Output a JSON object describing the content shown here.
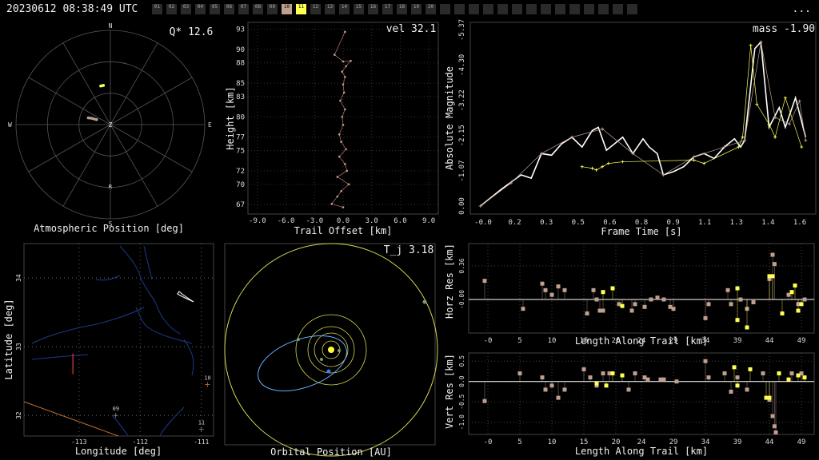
{
  "header": {
    "timestamp": "20230612 08:38:49 UTC",
    "more_label": "...",
    "stations": [
      {
        "label": "01",
        "active": false,
        "color": "#555555"
      },
      {
        "label": "02",
        "active": false,
        "color": "#555555"
      },
      {
        "label": "03",
        "active": false,
        "color": "#555555"
      },
      {
        "label": "04",
        "active": false,
        "color": "#555555"
      },
      {
        "label": "05",
        "active": false,
        "color": "#555555"
      },
      {
        "label": "06",
        "active": false,
        "color": "#555555"
      },
      {
        "label": "07",
        "active": false,
        "color": "#555555"
      },
      {
        "label": "08",
        "active": false,
        "color": "#555555"
      },
      {
        "label": "09",
        "active": false,
        "color": "#555555"
      },
      {
        "label": "10",
        "active": true,
        "color": "#bfa090"
      },
      {
        "label": "11",
        "active": true,
        "color": "#ffff55"
      },
      {
        "label": "12",
        "active": false,
        "color": "#555555"
      },
      {
        "label": "13",
        "active": false,
        "color": "#555555"
      },
      {
        "label": "14",
        "active": false,
        "color": "#555555"
      },
      {
        "label": "15",
        "active": false,
        "color": "#555555"
      },
      {
        "label": "16",
        "active": false,
        "color": "#555555"
      },
      {
        "label": "17",
        "active": false,
        "color": "#555555"
      },
      {
        "label": "18",
        "active": false,
        "color": "#555555"
      },
      {
        "label": "19",
        "active": false,
        "color": "#555555"
      },
      {
        "label": "20",
        "active": false,
        "color": "#555555"
      },
      {
        "label": "",
        "active": false,
        "color": "#333333"
      },
      {
        "label": "",
        "active": false,
        "color": "#333333"
      },
      {
        "label": "",
        "active": false,
        "color": "#333333"
      },
      {
        "label": "",
        "active": false,
        "color": "#333333"
      },
      {
        "label": "",
        "active": false,
        "color": "#333333"
      },
      {
        "label": "",
        "active": false,
        "color": "#333333"
      },
      {
        "label": "",
        "active": false,
        "color": "#333333"
      },
      {
        "label": "",
        "active": false,
        "color": "#333333"
      },
      {
        "label": "",
        "active": false,
        "color": "#333333"
      },
      {
        "label": "",
        "active": false,
        "color": "#333333"
      },
      {
        "label": "",
        "active": false,
        "color": "#333333"
      },
      {
        "label": "",
        "active": false,
        "color": "#333333"
      },
      {
        "label": "",
        "active": false,
        "color": "#333333"
      },
      {
        "label": "",
        "active": false,
        "color": "#333333"
      }
    ]
  },
  "colors": {
    "station_10": "#bfa090",
    "station_11": "#ffff55",
    "grid": "#555555",
    "orbit": "#6ab0ff",
    "orbit_ring": "#d8d850",
    "curve": "#ffffff"
  },
  "chart_data": [
    {
      "id": "polar",
      "type": "scatter",
      "xlabel": "Atmospheric Position [deg]",
      "stat": "Q* 12.6",
      "directions": [
        "N",
        "E",
        "S",
        "W",
        "Z",
        "R"
      ],
      "series": [
        {
          "station": "10",
          "points": [
            [
              -73,
              68
            ],
            [
              -72,
              70
            ],
            [
              -71,
              72
            ],
            [
              -71,
              74
            ],
            [
              -70,
              76
            ]
          ]
        },
        {
          "station": "11",
          "points": [
            [
              -10,
              52
            ],
            [
              -12,
              52
            ],
            [
              -14,
              52
            ]
          ]
        }
      ]
    },
    {
      "id": "height",
      "type": "scatter",
      "xlabel": "Trail Offset [km]",
      "ylabel": "Height [km]",
      "stat": "vel 32.1",
      "xlim": [
        -10,
        10
      ],
      "ylim": [
        65.6,
        94
      ],
      "xticks": [
        "-9.0",
        "-6.0",
        "-3.0",
        "0.0",
        "3.0",
        "6.0",
        "9.0"
      ],
      "yticks": [
        "67",
        "70",
        "72",
        "75",
        "77",
        "80",
        "83",
        "85",
        "88",
        "90",
        "93"
      ],
      "points": [
        [
          0.2,
          92.6
        ],
        [
          -0.9,
          89.2
        ],
        [
          0.0,
          88.2
        ],
        [
          0.8,
          88.3
        ],
        [
          0.3,
          87.5
        ],
        [
          -0.1,
          86.7
        ],
        [
          0.2,
          85.9
        ],
        [
          0.0,
          84.8
        ],
        [
          0.1,
          83.6
        ],
        [
          -0.3,
          82.4
        ],
        [
          0.2,
          81.1
        ],
        [
          -0.1,
          80.0
        ],
        [
          0.0,
          78.8
        ],
        [
          -0.4,
          77.4
        ],
        [
          -0.2,
          76.3
        ],
        [
          0.3,
          75.2
        ],
        [
          -0.4,
          74.1
        ],
        [
          0.2,
          73.0
        ],
        [
          0.4,
          72.0
        ],
        [
          -0.6,
          71.1
        ],
        [
          0.6,
          70.0
        ],
        [
          -0.2,
          69.0
        ],
        [
          -0.6,
          68.2
        ],
        [
          -1.2,
          67.1
        ],
        [
          0.0,
          66.6
        ]
      ]
    },
    {
      "id": "magnitude",
      "type": "line",
      "xlabel": "Frame Time [s]",
      "ylabel": "Absolute Magnitude",
      "stat": "mass -1.90",
      "xlim": [
        -0.05,
        1.65
      ],
      "ylim": [
        0,
        -5.6
      ],
      "xticks": [
        "-0.0",
        "0.2",
        "0.3",
        "0.5",
        "0.6",
        "0.8",
        "0.9",
        "1.1",
        "1.3",
        "1.4",
        "1.6"
      ],
      "yticks": [
        "0.00",
        "-1.07",
        "-2.15",
        "-3.22",
        "-4.30",
        "-5.37"
      ],
      "fit_curve": [
        [
          0.0,
          0.0
        ],
        [
          0.1,
          -0.5
        ],
        [
          0.2,
          -0.95
        ],
        [
          0.25,
          -0.85
        ],
        [
          0.3,
          -1.6
        ],
        [
          0.35,
          -1.55
        ],
        [
          0.4,
          -1.9
        ],
        [
          0.45,
          -2.1
        ],
        [
          0.5,
          -1.8
        ],
        [
          0.55,
          -2.3
        ],
        [
          0.58,
          -2.4
        ],
        [
          0.62,
          -1.7
        ],
        [
          0.67,
          -1.95
        ],
        [
          0.7,
          -2.1
        ],
        [
          0.75,
          -1.6
        ],
        [
          0.8,
          -2.05
        ],
        [
          0.83,
          -1.8
        ],
        [
          0.87,
          -1.6
        ],
        [
          0.9,
          -0.95
        ],
        [
          0.95,
          -1.05
        ],
        [
          1.0,
          -1.2
        ],
        [
          1.05,
          -1.5
        ],
        [
          1.1,
          -1.6
        ],
        [
          1.15,
          -1.45
        ],
        [
          1.2,
          -1.8
        ],
        [
          1.25,
          -2.05
        ],
        [
          1.28,
          -1.8
        ],
        [
          1.3,
          -2.0
        ],
        [
          1.35,
          -4.8
        ],
        [
          1.38,
          -5.0
        ],
        [
          1.42,
          -2.4
        ],
        [
          1.47,
          -3.0
        ],
        [
          1.5,
          -2.4
        ],
        [
          1.55,
          -3.3
        ],
        [
          1.6,
          -2.1
        ]
      ],
      "series": [
        {
          "station": "10",
          "points": [
            [
              0.0,
              0.0
            ],
            [
              0.15,
              -0.7
            ],
            [
              0.3,
              -1.6
            ],
            [
              0.45,
              -2.1
            ],
            [
              0.6,
              -2.35
            ],
            [
              0.75,
              -1.6
            ],
            [
              0.9,
              -0.95
            ],
            [
              1.05,
              -1.5
            ],
            [
              1.2,
              -1.8
            ],
            [
              1.3,
              -2.0
            ],
            [
              1.38,
              -5.0
            ],
            [
              1.45,
              -2.7
            ],
            [
              1.52,
              -2.5
            ],
            [
              1.57,
              -3.2
            ],
            [
              1.6,
              -2.0
            ]
          ]
        },
        {
          "station": "11",
          "points": [
            [
              0.5,
              -1.2
            ],
            [
              0.55,
              -1.15
            ],
            [
              0.57,
              -1.1
            ],
            [
              0.6,
              -1.2
            ],
            [
              0.63,
              -1.3
            ],
            [
              0.7,
              -1.35
            ],
            [
              1.05,
              -1.4
            ],
            [
              1.1,
              -1.3
            ],
            [
              1.27,
              -1.8
            ],
            [
              1.29,
              -2.1
            ],
            [
              1.33,
              -4.9
            ],
            [
              1.36,
              -3.1
            ],
            [
              1.42,
              -2.5
            ],
            [
              1.45,
              -2.1
            ],
            [
              1.5,
              -3.3
            ],
            [
              1.58,
              -1.8
            ]
          ]
        }
      ]
    },
    {
      "id": "map",
      "type": "scatter",
      "xlabel": "Longitude [deg]",
      "ylabel": "Latitude [deg]",
      "xlim": [
        -113.9,
        -110.8
      ],
      "ylim": [
        31.7,
        34.5
      ],
      "xticks": [
        "-113",
        "-112",
        "-111"
      ],
      "yticks": [
        "32",
        "33",
        "34"
      ],
      "station_labels": [
        {
          "label": "10",
          "lon": -110.9,
          "lat": 32.45
        },
        {
          "label": "09",
          "lon": -112.4,
          "lat": 32.0
        },
        {
          "label": "11",
          "lon": -111.0,
          "lat": 31.8
        }
      ],
      "track": [
        [
          -113.1,
          32.9
        ],
        [
          -113.1,
          32.6
        ]
      ]
    },
    {
      "id": "orbit",
      "type": "scatter",
      "xlabel": "Orbital Position [AU]",
      "stat": "T_j 3.18"
    },
    {
      "id": "horz_res",
      "type": "scatter",
      "xlabel": "Length Along Trail [km]",
      "ylabel": "Horz Res [km]",
      "xlim": [
        -3,
        51
      ],
      "ylim": [
        -0.36,
        0.6
      ],
      "xticks": [
        "-0",
        "5",
        "10",
        "15",
        "20",
        "24",
        "29",
        "34",
        "39",
        "44",
        "49"
      ],
      "yticks": [
        "0.36",
        "-0.00"
      ],
      "series": [
        {
          "station": "10",
          "points": [
            [
              -0.5,
              0.2
            ],
            [
              5.5,
              -0.1
            ],
            [
              8.5,
              0.17
            ],
            [
              9,
              0.1
            ],
            [
              10,
              0.05
            ],
            [
              11,
              0.14
            ],
            [
              12,
              0.1
            ],
            [
              15.5,
              -0.15
            ],
            [
              16.5,
              0.1
            ],
            [
              17,
              0.0
            ],
            [
              17.5,
              -0.12
            ],
            [
              18,
              -0.12
            ],
            [
              20.5,
              -0.05
            ],
            [
              22.5,
              -0.12
            ],
            [
              23,
              -0.05
            ],
            [
              24.5,
              -0.08
            ],
            [
              25.5,
              0.0
            ],
            [
              26.5,
              0.02
            ],
            [
              27.5,
              0.0
            ],
            [
              28.5,
              -0.08
            ],
            [
              29,
              -0.1
            ],
            [
              34,
              -0.2
            ],
            [
              34.5,
              -0.05
            ],
            [
              37.5,
              0.1
            ],
            [
              38,
              -0.05
            ],
            [
              39.5,
              0.0
            ],
            [
              40.5,
              -0.1
            ],
            [
              41.5,
              -0.03
            ],
            [
              44,
              0.22
            ],
            [
              44.5,
              0.48
            ],
            [
              44.8,
              0.38
            ],
            [
              47,
              0.05
            ],
            [
              48.5,
              -0.05
            ],
            [
              49.5,
              0.0
            ]
          ]
        },
        {
          "station": "11",
          "points": [
            [
              18,
              0.08
            ],
            [
              19.5,
              0.12
            ],
            [
              21,
              -0.07
            ],
            [
              39,
              0.12
            ],
            [
              44,
              0.25
            ],
            [
              44.5,
              0.25
            ],
            [
              47.5,
              0.08
            ],
            [
              48,
              0.15
            ],
            [
              48.5,
              -0.12
            ],
            [
              40.5,
              -0.3
            ],
            [
              39,
              -0.22
            ],
            [
              46,
              -0.15
            ],
            [
              49,
              -0.05
            ]
          ]
        }
      ]
    },
    {
      "id": "vert_res",
      "type": "scatter",
      "xlabel": "Length Along Trail [km]",
      "ylabel": "Vert Res [km]",
      "xlim": [
        -3,
        51
      ],
      "ylim": [
        -1.3,
        0.7
      ],
      "xticks": [
        "-0",
        "5",
        "10",
        "15",
        "20",
        "24",
        "29",
        "34",
        "39",
        "44",
        "49"
      ],
      "yticks": [
        "0.5",
        "0.0",
        "-0.5",
        "-1.0"
      ],
      "series": [
        {
          "station": "10",
          "points": [
            [
              -0.5,
              -0.48
            ],
            [
              5,
              0.2
            ],
            [
              8.5,
              0.1
            ],
            [
              9,
              -0.2
            ],
            [
              10,
              -0.1
            ],
            [
              11,
              -0.4
            ],
            [
              12,
              -0.2
            ],
            [
              15,
              0.3
            ],
            [
              16,
              0.1
            ],
            [
              17,
              -0.1
            ],
            [
              18,
              0.2
            ],
            [
              19,
              0.2
            ],
            [
              22,
              -0.2
            ],
            [
              23,
              0.2
            ],
            [
              24.5,
              0.1
            ],
            [
              25,
              0.05
            ],
            [
              27,
              0.05
            ],
            [
              27.5,
              0.05
            ],
            [
              29.5,
              0.0
            ],
            [
              34,
              0.5
            ],
            [
              34.5,
              0.1
            ],
            [
              37,
              0.2
            ],
            [
              38,
              -0.25
            ],
            [
              39,
              0.1
            ],
            [
              40.5,
              -0.2
            ],
            [
              43,
              0.2
            ],
            [
              44,
              -0.45
            ],
            [
              44.5,
              -0.85
            ],
            [
              44.8,
              -1.1
            ],
            [
              45,
              -1.25
            ],
            [
              47.5,
              0.2
            ],
            [
              49,
              0.2
            ]
          ]
        },
        {
          "station": "11",
          "points": [
            [
              17,
              -0.05
            ],
            [
              18.5,
              -0.1
            ],
            [
              19.5,
              0.2
            ],
            [
              21,
              0.15
            ],
            [
              38.5,
              0.35
            ],
            [
              39,
              -0.1
            ],
            [
              41,
              0.3
            ],
            [
              43.5,
              -0.4
            ],
            [
              44,
              -0.4
            ],
            [
              45.5,
              0.2
            ],
            [
              47,
              0.05
            ],
            [
              48.5,
              0.15
            ],
            [
              49.5,
              0.1
            ]
          ]
        }
      ]
    }
  ]
}
